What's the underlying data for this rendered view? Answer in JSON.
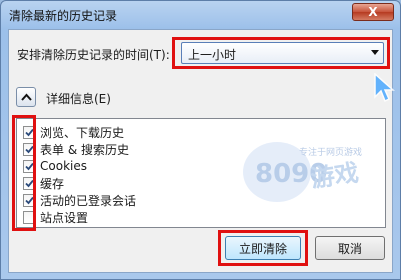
{
  "window": {
    "title": "清除最新的历史记录",
    "close_label": "X"
  },
  "time_range": {
    "label": "安排清除历史记录的时间(T):",
    "selected": "上一小时"
  },
  "details": {
    "label": "详细信息(E)"
  },
  "items": [
    {
      "label": "浏览、下载历史",
      "checked": true
    },
    {
      "label": "表单 & 搜索历史",
      "checked": true
    },
    {
      "label": "Cookies",
      "checked": true
    },
    {
      "label": "缓存",
      "checked": true
    },
    {
      "label": "活动的已登录会话",
      "checked": true
    },
    {
      "label": "站点设置",
      "checked": false
    }
  ],
  "buttons": {
    "clear_now": "立即清除",
    "cancel": "取消"
  },
  "watermark": {
    "logo_text": "8090游戏",
    "slogan": "专注于网页游戏"
  },
  "colors": {
    "highlight": "#e01010",
    "title_bar": "#9cc0ea"
  }
}
